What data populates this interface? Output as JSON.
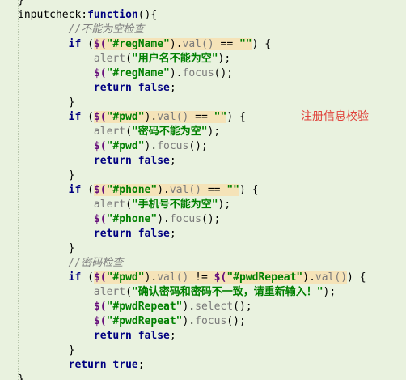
{
  "note": "注册信息校验",
  "code": {
    "lines": [
      [
        {
          "t": "}",
          "c": "plain"
        }
      ],
      [
        {
          "t": "inputcheck",
          "c": "plain"
        },
        {
          "t": ":",
          "c": "plain"
        },
        {
          "t": "function",
          "c": "kw"
        },
        {
          "t": "(){",
          "c": "plain"
        }
      ],
      [
        {
          "t": "        ",
          "c": "plain"
        },
        {
          "t": "//不能为空检查",
          "c": "cm"
        }
      ],
      [
        {
          "t": "        ",
          "c": "plain"
        },
        {
          "t": "if",
          "c": "kw"
        },
        {
          "t": " (",
          "c": "plain"
        },
        {
          "t": "$(\"#regName\").val() == \"\"",
          "c": "hl"
        },
        {
          "t": ") {",
          "c": "plain"
        }
      ],
      [
        {
          "t": "            ",
          "c": "plain"
        },
        {
          "t": "alert",
          "c": "fn"
        },
        {
          "t": "(",
          "c": "plain"
        },
        {
          "t": "\"用户名不能为空\"",
          "c": "str"
        },
        {
          "t": ");",
          "c": "plain"
        }
      ],
      [
        {
          "t": "            ",
          "c": "plain"
        },
        {
          "t": "$(",
          "c": "sel"
        },
        {
          "t": "\"#regName\"",
          "c": "str"
        },
        {
          "t": ").",
          "c": "plain"
        },
        {
          "t": "focus",
          "c": "fn"
        },
        {
          "t": "();",
          "c": "plain"
        }
      ],
      [
        {
          "t": "            ",
          "c": "plain"
        },
        {
          "t": "return",
          "c": "kw"
        },
        {
          "t": " ",
          "c": "plain"
        },
        {
          "t": "false",
          "c": "kw"
        },
        {
          "t": ";",
          "c": "plain"
        }
      ],
      [
        {
          "t": "        }",
          "c": "plain"
        }
      ],
      [
        {
          "t": "        ",
          "c": "plain"
        },
        {
          "t": "if",
          "c": "kw"
        },
        {
          "t": " (",
          "c": "plain"
        },
        {
          "t": "$(\"#pwd\").val() == \"\"",
          "c": "hl"
        },
        {
          "t": ") {",
          "c": "plain"
        }
      ],
      [
        {
          "t": "            ",
          "c": "plain"
        },
        {
          "t": "alert",
          "c": "fn"
        },
        {
          "t": "(",
          "c": "plain"
        },
        {
          "t": "\"密码不能为空\"",
          "c": "str"
        },
        {
          "t": ");",
          "c": "plain"
        }
      ],
      [
        {
          "t": "            ",
          "c": "plain"
        },
        {
          "t": "$(",
          "c": "sel"
        },
        {
          "t": "\"#pwd\"",
          "c": "str"
        },
        {
          "t": ").",
          "c": "plain"
        },
        {
          "t": "focus",
          "c": "fn"
        },
        {
          "t": "();",
          "c": "plain"
        }
      ],
      [
        {
          "t": "            ",
          "c": "plain"
        },
        {
          "t": "return",
          "c": "kw"
        },
        {
          "t": " ",
          "c": "plain"
        },
        {
          "t": "false",
          "c": "kw"
        },
        {
          "t": ";",
          "c": "plain"
        }
      ],
      [
        {
          "t": "        }",
          "c": "plain"
        }
      ],
      [
        {
          "t": "        ",
          "c": "plain"
        },
        {
          "t": "if",
          "c": "kw"
        },
        {
          "t": " (",
          "c": "plain"
        },
        {
          "t": "$(\"#phone\").val() == \"\"",
          "c": "hl"
        },
        {
          "t": ") {",
          "c": "plain"
        }
      ],
      [
        {
          "t": "            ",
          "c": "plain"
        },
        {
          "t": "alert",
          "c": "fn"
        },
        {
          "t": "(",
          "c": "plain"
        },
        {
          "t": "\"手机号不能为空\"",
          "c": "str"
        },
        {
          "t": ");",
          "c": "plain"
        }
      ],
      [
        {
          "t": "            ",
          "c": "plain"
        },
        {
          "t": "$(",
          "c": "sel"
        },
        {
          "t": "\"#phone\"",
          "c": "str"
        },
        {
          "t": ").",
          "c": "plain"
        },
        {
          "t": "focus",
          "c": "fn"
        },
        {
          "t": "();",
          "c": "plain"
        }
      ],
      [
        {
          "t": "            ",
          "c": "plain"
        },
        {
          "t": "return",
          "c": "kw"
        },
        {
          "t": " ",
          "c": "plain"
        },
        {
          "t": "false",
          "c": "kw"
        },
        {
          "t": ";",
          "c": "plain"
        }
      ],
      [
        {
          "t": "        }",
          "c": "plain"
        }
      ],
      [
        {
          "t": "        ",
          "c": "plain"
        },
        {
          "t": "//密码检查",
          "c": "cm"
        }
      ],
      [
        {
          "t": "        ",
          "c": "plain"
        },
        {
          "t": "if",
          "c": "kw"
        },
        {
          "t": " (",
          "c": "plain"
        },
        {
          "t": "$(\"#pwd\").val() != $(\"#pwdRepeat\").val()",
          "c": "hl"
        },
        {
          "t": ") {",
          "c": "plain"
        }
      ],
      [
        {
          "t": "            ",
          "c": "plain"
        },
        {
          "t": "alert",
          "c": "fn"
        },
        {
          "t": "(",
          "c": "plain"
        },
        {
          "t": "\"确认密码和密码不一致，请重新输入！\"",
          "c": "str"
        },
        {
          "t": ");",
          "c": "plain"
        }
      ],
      [
        {
          "t": "            ",
          "c": "plain"
        },
        {
          "t": "$(",
          "c": "sel"
        },
        {
          "t": "\"#pwdRepeat\"",
          "c": "str"
        },
        {
          "t": ").",
          "c": "plain"
        },
        {
          "t": "select",
          "c": "fn"
        },
        {
          "t": "();",
          "c": "plain"
        }
      ],
      [
        {
          "t": "            ",
          "c": "plain"
        },
        {
          "t": "$(",
          "c": "sel"
        },
        {
          "t": "\"#pwdRepeat\"",
          "c": "str"
        },
        {
          "t": ").",
          "c": "plain"
        },
        {
          "t": "focus",
          "c": "fn"
        },
        {
          "t": "();",
          "c": "plain"
        }
      ],
      [
        {
          "t": "            ",
          "c": "plain"
        },
        {
          "t": "return",
          "c": "kw"
        },
        {
          "t": " ",
          "c": "plain"
        },
        {
          "t": "false",
          "c": "kw"
        },
        {
          "t": ";",
          "c": "plain"
        }
      ],
      [
        {
          "t": "        }",
          "c": "plain"
        }
      ],
      [
        {
          "t": "        ",
          "c": "plain"
        },
        {
          "t": "return",
          "c": "kw"
        },
        {
          "t": " ",
          "c": "plain"
        },
        {
          "t": "true",
          "c": "kw"
        },
        {
          "t": ";",
          "c": "plain"
        }
      ],
      [
        {
          "t": "},",
          "c": "plain"
        }
      ]
    ]
  }
}
